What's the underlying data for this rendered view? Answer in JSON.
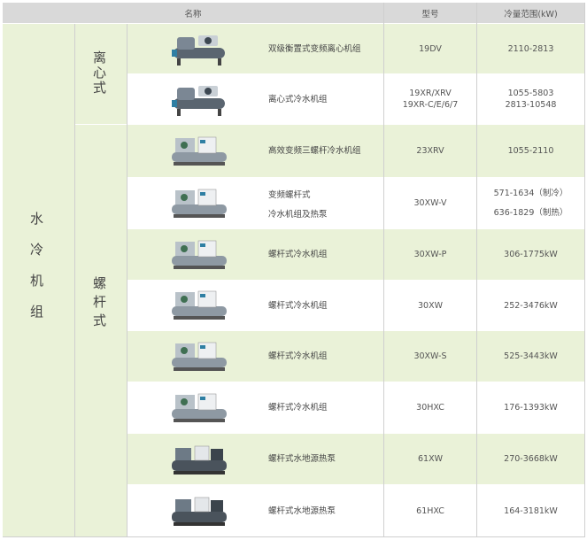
{
  "header": {
    "name": "名称",
    "model": "型号",
    "capacity": "冷量范围(kW)"
  },
  "group": "水冷机组",
  "subgroups": {
    "centrifugal": "离心式",
    "screw": "螺杆式"
  },
  "rows": [
    {
      "name": [
        "双级衡置式变频离心机组"
      ],
      "model": [
        "19DV"
      ],
      "capacity": [
        "2110-2813"
      ],
      "icon": "centrifugal-chiller-image"
    },
    {
      "name": [
        "离心式冷水机组"
      ],
      "model": [
        "19XR/XRV",
        "19XR-C/E/6/7"
      ],
      "capacity": [
        "1055-5803",
        "2813-10548"
      ],
      "icon": "centrifugal-chiller-image"
    },
    {
      "name": [
        "高效变频三螺杆冷水机组"
      ],
      "model": [
        "23XRV"
      ],
      "capacity": [
        "1055-2110"
      ],
      "icon": "screw-chiller-image"
    },
    {
      "name": [
        "变频螺杆式",
        "冷水机组及热泵"
      ],
      "model": [
        "30XW-V"
      ],
      "capacity": [
        "571-1634（制冷）",
        "636-1829（制热）"
      ],
      "icon": "screw-chiller-image"
    },
    {
      "name": [
        "螺杆式冷水机组"
      ],
      "model": [
        "30XW-P"
      ],
      "capacity": [
        "306-1775kW"
      ],
      "icon": "screw-chiller-image"
    },
    {
      "name": [
        "螺杆式冷水机组"
      ],
      "model": [
        "30XW"
      ],
      "capacity": [
        "252-3476kW"
      ],
      "icon": "screw-chiller-image"
    },
    {
      "name": [
        "螺杆式冷水机组"
      ],
      "model": [
        "30XW-S"
      ],
      "capacity": [
        "525-3443kW"
      ],
      "icon": "screw-chiller-image"
    },
    {
      "name": [
        "螺杆式冷水机组"
      ],
      "model": [
        "30HXC"
      ],
      "capacity": [
        "176-1393kW"
      ],
      "icon": "screw-chiller-image"
    },
    {
      "name": [
        "螺杆式水地源热泵"
      ],
      "model": [
        "61XW"
      ],
      "capacity": [
        "270-3668kW"
      ],
      "icon": "water-source-heat-pump-image"
    },
    {
      "name": [
        "螺杆式水地源热泵"
      ],
      "model": [
        "61HXC"
      ],
      "capacity": [
        "164-3181kW"
      ],
      "icon": "water-source-heat-pump-image"
    }
  ]
}
